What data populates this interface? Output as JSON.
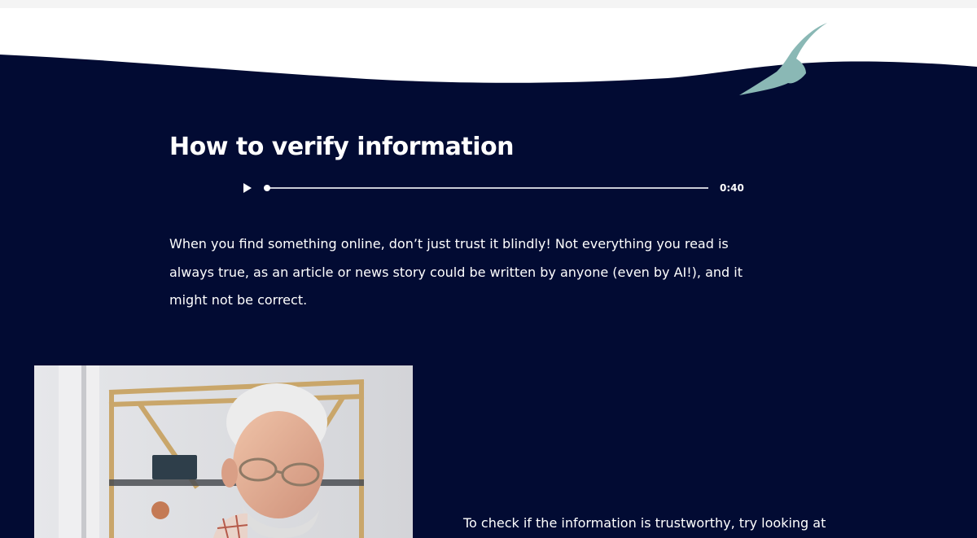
{
  "colors": {
    "background_navy": "#020b33",
    "page_white": "#ffffff",
    "bird_teal": "#8ab8b5",
    "text": "#ffffff"
  },
  "section": {
    "title": "How to verify information",
    "intro_lines": [
      "When you find something online, don’t just trust it blindly! Not everything you read is",
      "always true, as an article or news story could be written by anyone (even by AI!), and it",
      "might not be correct."
    ],
    "second_paragraph": "To check if the information is trustworthy, try looking at"
  },
  "audio": {
    "duration_label": "0:40",
    "progress_fraction": 0
  },
  "icons": {
    "play": "play-icon",
    "bird": "seagull-icon"
  },
  "photo": {
    "subject": "elderly-man-reading-photo"
  }
}
